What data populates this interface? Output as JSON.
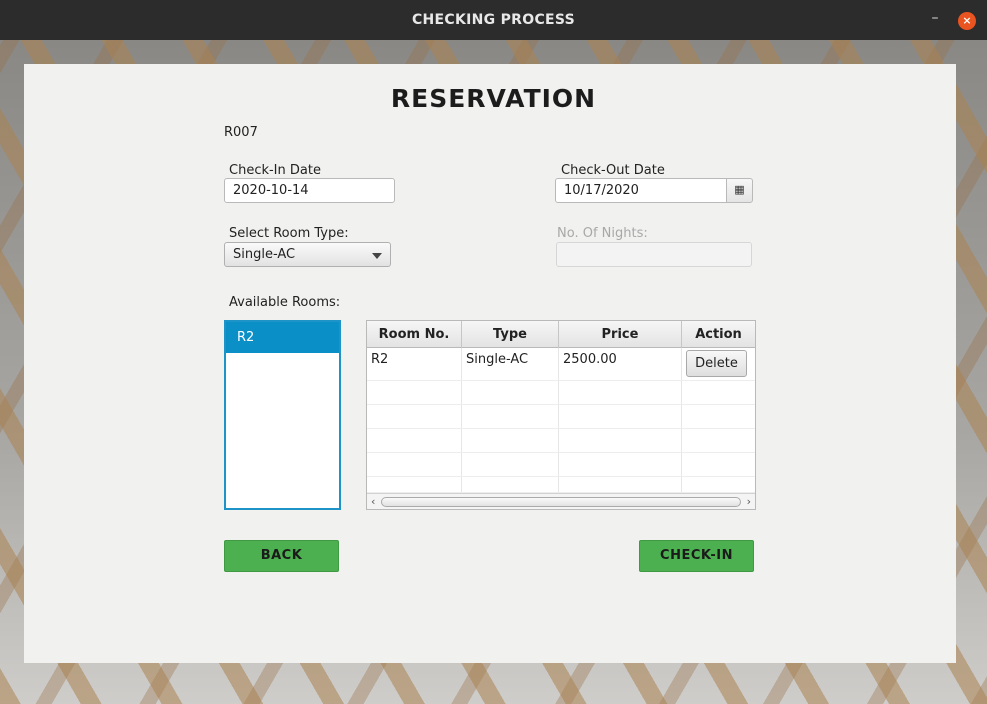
{
  "window": {
    "title": "CHECKING PROCESS",
    "minimize_glyph": "–",
    "close_glyph": "×"
  },
  "heading": "RESERVATION",
  "reservation_id": "R007",
  "checkin": {
    "label": "Check-In Date",
    "value": "2020-10-14"
  },
  "checkout": {
    "label": "Check-Out Date",
    "value": "10/17/2020",
    "picker_icon": "calendar-icon",
    "picker_glyph": "▦"
  },
  "room_type": {
    "label": "Select Room Type:",
    "selected": "Single-AC"
  },
  "nights": {
    "label": "No. Of Nights:",
    "value": ""
  },
  "available_rooms": {
    "label": "Available Rooms:",
    "items": [
      "R2"
    ]
  },
  "table": {
    "columns": [
      "Room No.",
      "Type",
      "Price",
      "Action"
    ],
    "rows": [
      {
        "room_no": "R2",
        "type": "Single-AC",
        "price": "2500.00",
        "action": "Delete"
      }
    ],
    "scroll_left": "‹",
    "scroll_right": "›"
  },
  "buttons": {
    "back": "BACK",
    "checkin": "CHECK-IN"
  },
  "colors": {
    "accent": "#4caf50",
    "selection": "#0a8fc7",
    "close": "#e95420"
  }
}
